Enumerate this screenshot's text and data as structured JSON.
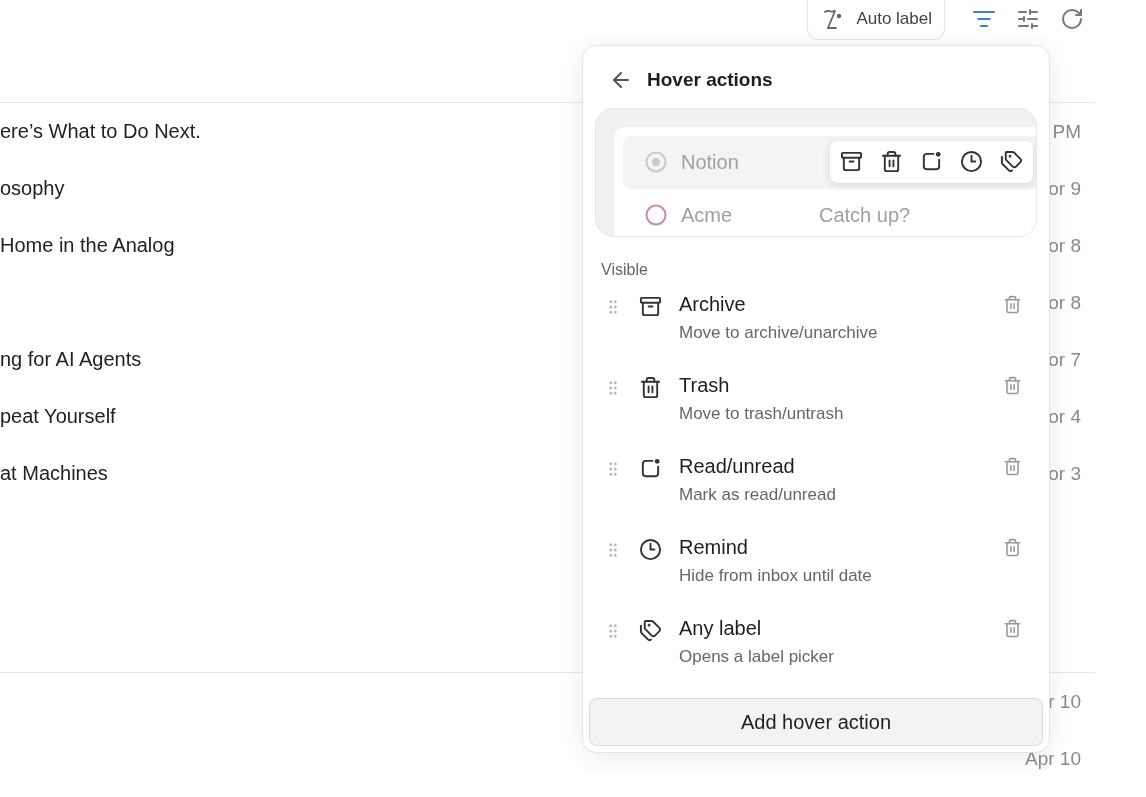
{
  "toolbar": {
    "auto_label": "Auto label",
    "filter_active": true
  },
  "rows": [
    {
      "title": "ere’s What to Do Next.",
      "date": "PM"
    },
    {
      "title": "osophy",
      "date": "or 9"
    },
    {
      "title": "Home in the Analog",
      "date": "or 8"
    },
    {
      "date": "or 8"
    },
    {
      "title": "ng for AI Agents",
      "date": "or 7"
    },
    {
      "title": "peat Yourself",
      "date": "or 4"
    },
    {
      "title": "at Machines",
      "date": "or 3"
    }
  ],
  "rows_below": [
    {
      "date": "r 10"
    },
    {
      "date": "Apr 10"
    }
  ],
  "popover": {
    "title": "Hover actions",
    "preview": [
      {
        "sender": "Notion",
        "highlighted": true,
        "color": "#c8c8c8"
      },
      {
        "sender": "Acme",
        "subject": "Catch up?",
        "highlighted": false,
        "color": "#c98aa8"
      }
    ],
    "preview_actions": [
      {
        "kind": "archive"
      },
      {
        "kind": "trash"
      },
      {
        "kind": "read"
      },
      {
        "kind": "remind"
      },
      {
        "kind": "label"
      }
    ],
    "section": "Visible",
    "actions": [
      {
        "kind": "archive",
        "title": "Archive",
        "description": "Move to archive/unarchive"
      },
      {
        "kind": "trash",
        "title": "Trash",
        "description": "Move to trash/untrash"
      },
      {
        "kind": "read",
        "title": "Read/unread",
        "description": "Mark as read/unread"
      },
      {
        "kind": "remind",
        "title": "Remind",
        "description": "Hide from inbox until date"
      },
      {
        "kind": "label",
        "title": "Any label",
        "description": "Opens a label picker"
      }
    ],
    "add_button": "Add hover action"
  }
}
